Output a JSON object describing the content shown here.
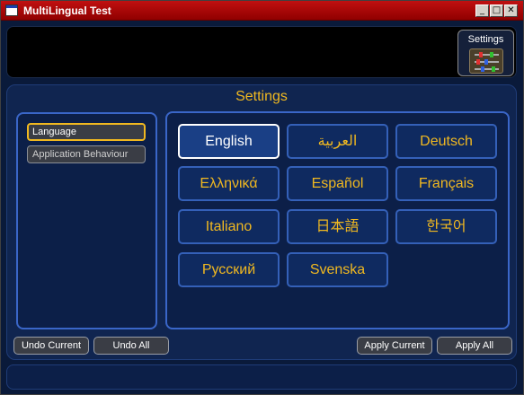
{
  "window": {
    "title": "MultiLingual Test"
  },
  "window_controls": {
    "minimize": "_",
    "maximize": "□",
    "close": "✕"
  },
  "toolbar": {
    "settings_label": "Settings",
    "settings_icon": "sliders-icon"
  },
  "panel": {
    "title": "Settings"
  },
  "nav": {
    "items": [
      {
        "label": "Language"
      },
      {
        "label": "Application Behaviour"
      }
    ]
  },
  "languages": [
    {
      "label": "English"
    },
    {
      "label": "العربية"
    },
    {
      "label": "Deutsch"
    },
    {
      "label": "Ελληνικά"
    },
    {
      "label": "Español"
    },
    {
      "label": "Français"
    },
    {
      "label": "Italiano"
    },
    {
      "label": "日本語"
    },
    {
      "label": "한국어"
    },
    {
      "label": "Русский"
    },
    {
      "label": "Svenska"
    }
  ],
  "actions": {
    "undo_current": "Undo Current",
    "undo_all": "Undo All",
    "apply_current": "Apply Current",
    "apply_all": "Apply All"
  },
  "colors": {
    "accent": "#f0b820",
    "panel_border": "#3a66c8",
    "background": "#0a1a3a",
    "titlebar": "#c01010"
  }
}
